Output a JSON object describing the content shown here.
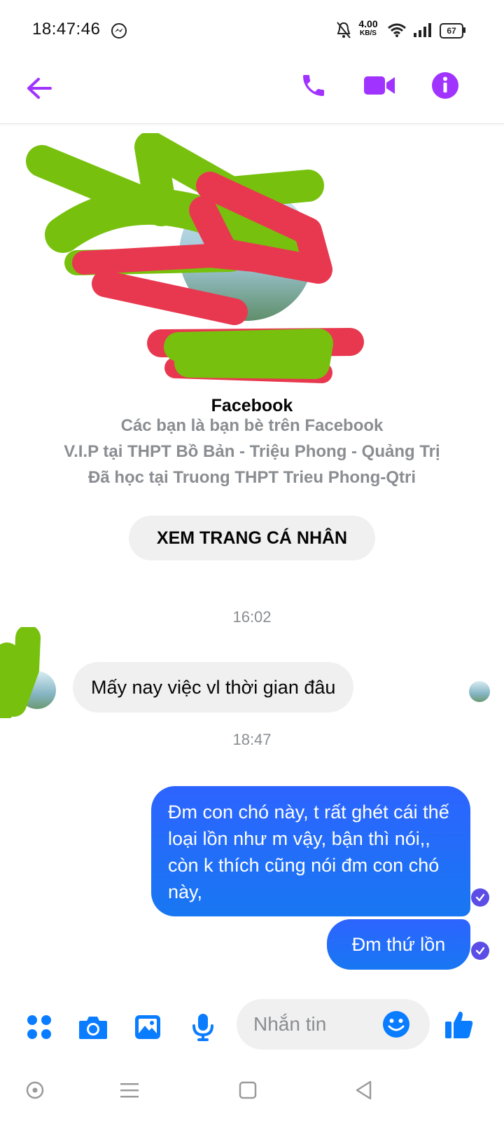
{
  "status_bar": {
    "time": "18:47:46",
    "net_speed_value": "4.00",
    "net_speed_unit": "KB/S",
    "battery": "67"
  },
  "header": {
    "back_icon": "arrow-left-icon",
    "call_icon": "phone-icon",
    "video_icon": "video-camera-icon",
    "info_icon": "info-icon",
    "accent_color": "#a033ff"
  },
  "profile": {
    "name_suffix": "Facebook",
    "friend_status": "Các bạn là bạn bè trên Facebook",
    "work": "V.I.P tại THPT Bồ Bản - Triệu Phong - Quảng Trị",
    "education": "Đã học tại Truong THPT Trieu Phong-Qtri",
    "view_profile_label": "XEM TRANG CÁ NHÂN"
  },
  "messages": [
    {
      "timestamp": "16:02"
    },
    {
      "direction": "incoming",
      "text": "Mấy nay việc vl thời gian đâu"
    },
    {
      "timestamp": "18:47"
    },
    {
      "direction": "outgoing",
      "text": "Đm con chó này, t rất ghét cái thế loại lồn như m vậy, bận thì nói,, còn k thích cũng nói đm con chó này,"
    },
    {
      "direction": "outgoing",
      "text": "Đm thứ lồn"
    }
  ],
  "composer": {
    "placeholder": "Nhắn tin",
    "icons": [
      "apps-icon",
      "camera-icon",
      "gallery-icon",
      "microphone-icon",
      "emoji-icon",
      "thumbs-up-icon"
    ],
    "accent_color": "#0a7cff"
  },
  "nav_bar": {
    "icons": [
      "circle-icon",
      "menu-icon",
      "square-icon",
      "back-triangle-icon"
    ]
  }
}
